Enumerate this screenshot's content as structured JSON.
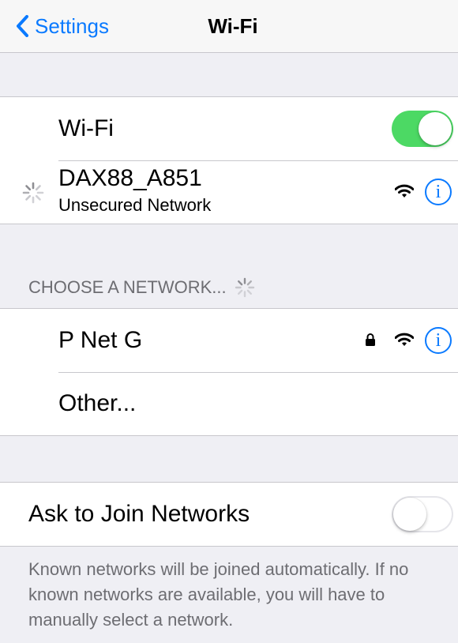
{
  "navbar": {
    "back_label": "Settings",
    "title": "Wi-Fi"
  },
  "wifi_toggle": {
    "label": "Wi-Fi",
    "state": "on"
  },
  "current_network": {
    "name": "DAX88_A851",
    "status": "Unsecured Network"
  },
  "choose_header": "CHOOSE A NETWORK...",
  "networks": [
    {
      "name": "P Net G",
      "locked": true
    }
  ],
  "other_label": "Other...",
  "ask_to_join": {
    "label": "Ask to Join Networks",
    "state": "off"
  },
  "footer_text": "Known networks will be joined automatically. If no known networks are available, you will have to manually select a network.",
  "colors": {
    "accent": "#0a7aff",
    "toggle_on": "#4cd964",
    "background": "#efeff4"
  }
}
